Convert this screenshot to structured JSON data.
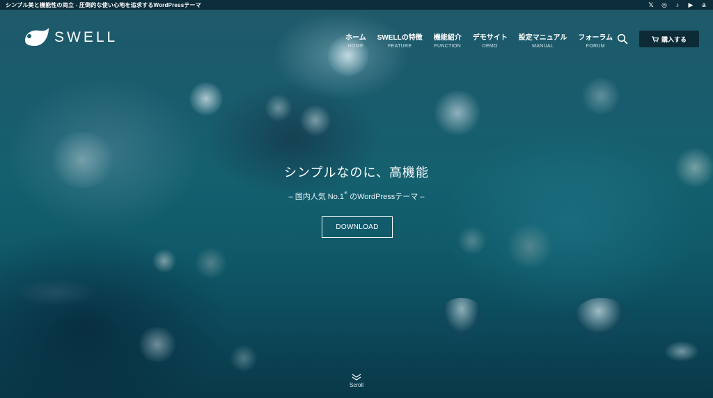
{
  "topbar": {
    "tagline": "シンプル美と機能性の両立 - 圧倒的な使い心地を追求するWordPressテーマ",
    "social_icons": [
      "x-icon",
      "instagram-icon",
      "tiktok-icon",
      "youtube-icon",
      "amazon-icon"
    ],
    "social_glyphs": [
      "𝕏",
      "◎",
      "♪",
      "▶",
      "a"
    ]
  },
  "header": {
    "logo_text": "SWELL",
    "nav": [
      {
        "ja": "ホーム",
        "en": "HOME"
      },
      {
        "ja": "SWELLの特徴",
        "en": "FEATURE"
      },
      {
        "ja": "機能紹介",
        "en": "FUNCTION"
      },
      {
        "ja": "デモサイト",
        "en": "DEMO"
      },
      {
        "ja": "設定マニュアル",
        "en": "MANUAL"
      },
      {
        "ja": "フォーラム",
        "en": "FORUM"
      }
    ],
    "buy_label": "購入する"
  },
  "hero": {
    "title": "シンプルなのに、高機能",
    "subtitle_prefix": "– 国内人気 No.1",
    "subtitle_sup": "※",
    "subtitle_suffix": " のWordPressテーマ –",
    "download_label": "DOWNLOAD"
  },
  "scroll": {
    "label": "Scroll"
  },
  "colors": {
    "topbar_bg": "#0c2d3b",
    "buy_bg": "#0d2a37",
    "text": "#ffffff"
  }
}
